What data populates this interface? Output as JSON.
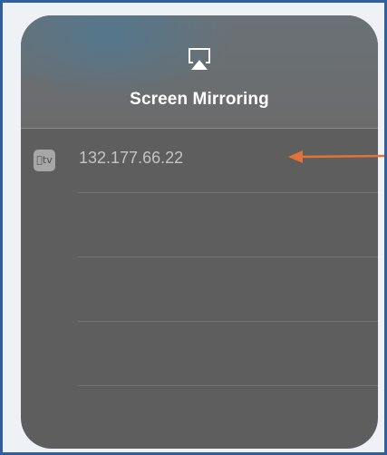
{
  "panel": {
    "title": "Screen Mirroring",
    "header_icon": "airplay-icon"
  },
  "devices": [
    {
      "icon": "apple-tv-icon",
      "icon_text": "tv",
      "label": "132.177.66.22"
    }
  ],
  "empty_rows": 3,
  "annotation": {
    "type": "arrow",
    "color": "#e0723a",
    "points_to": "device-row"
  },
  "colors": {
    "frame_border": "#2f5f9e",
    "panel_bg": "#5e5e5e",
    "title": "#ffffff",
    "device_label": "#c4c4c4"
  }
}
